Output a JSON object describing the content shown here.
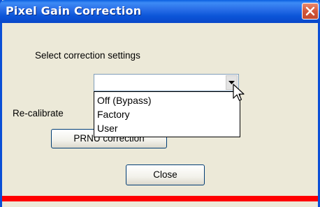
{
  "window": {
    "title": "Pixel Gain Correction"
  },
  "labels": {
    "select_settings": "Select correction settings",
    "recalibrate": "Re-calibrate"
  },
  "combo": {
    "value": ""
  },
  "dropdown": {
    "options": [
      "Off (Bypass)",
      "Factory",
      "User"
    ]
  },
  "buttons": {
    "prnu": "PRNU correction",
    "close": "Close"
  },
  "icons": {
    "close": "close-x-icon",
    "dropdown": "chevron-down-icon",
    "cursor": "mouse-pointer-icon"
  },
  "colors": {
    "titlebar": "#0a55d8",
    "close_button": "#d2563a",
    "status_bar": "#ff0000",
    "background": "#ece9d8"
  }
}
